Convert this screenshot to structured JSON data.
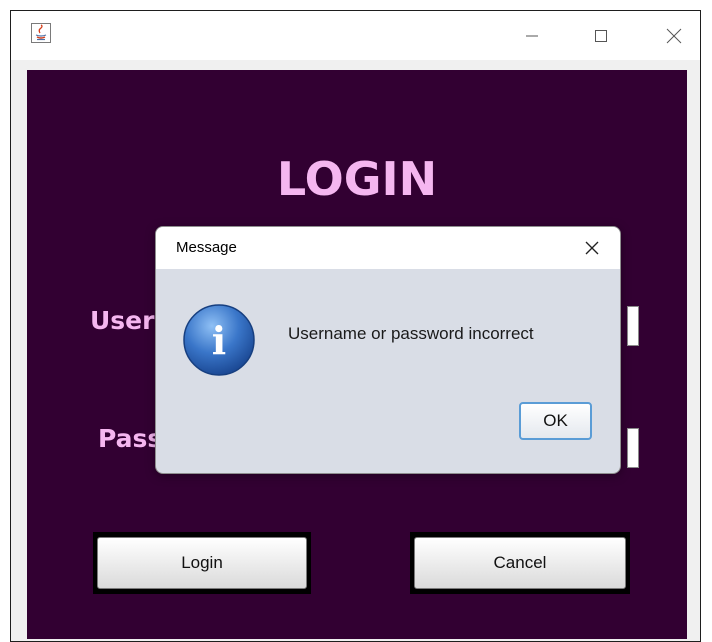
{
  "window": {
    "title": "",
    "controls": {
      "minimize_icon": "minimize-icon",
      "maximize_icon": "maximize-icon",
      "close_icon": "close-icon"
    }
  },
  "login_form": {
    "title": "LOGIN",
    "username_label_visible": "User",
    "password_label_visible": "Pass",
    "login_button": "Login",
    "cancel_button": "Cancel",
    "background_color": "#320032",
    "label_color": "#f5b6f0"
  },
  "dialog": {
    "title": "Message",
    "message": "Username or password incorrect",
    "ok_button": "OK",
    "icon": "info-icon",
    "icon_glyph": "i"
  }
}
